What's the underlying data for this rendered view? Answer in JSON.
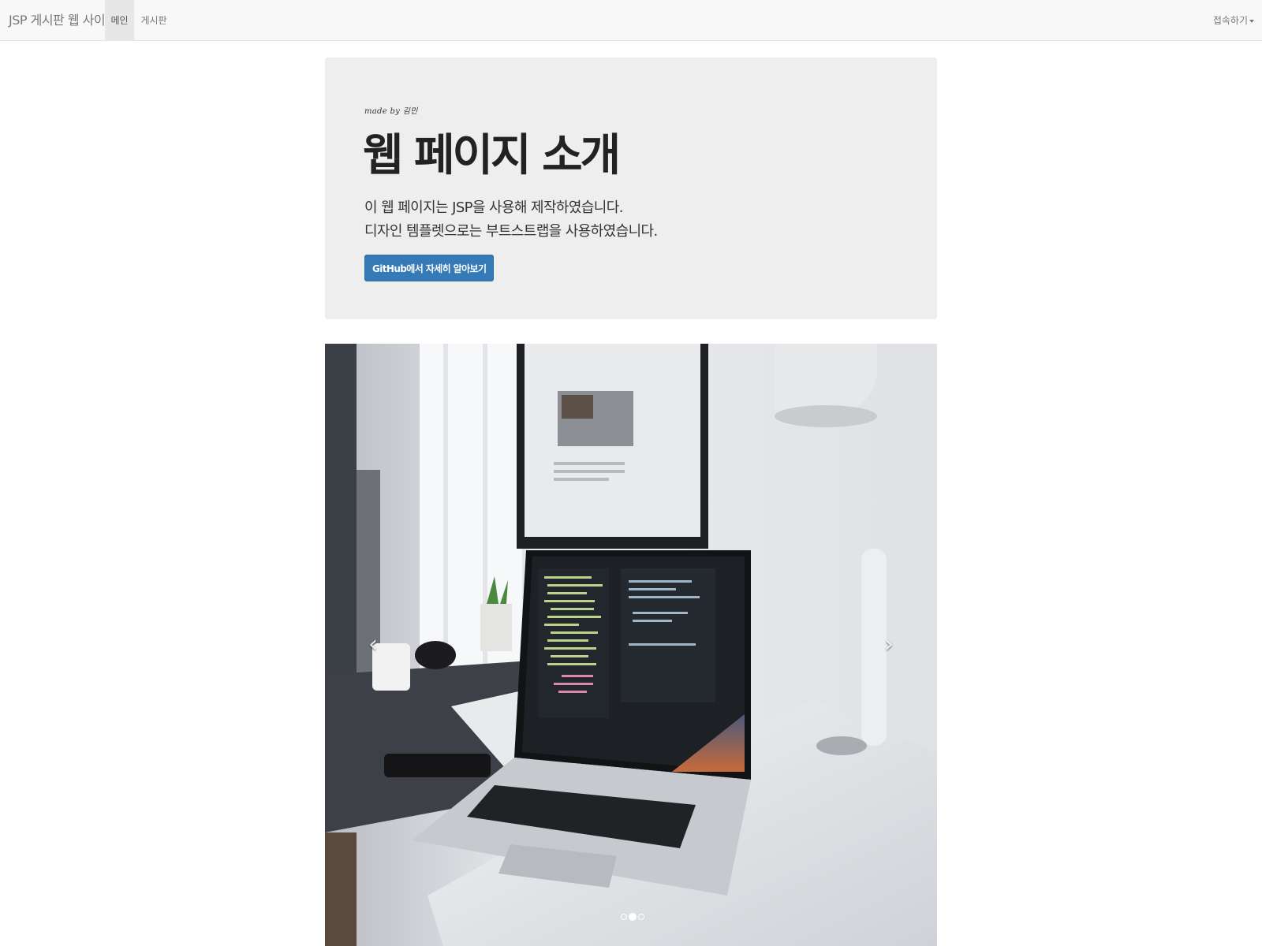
{
  "navbar": {
    "brand": "JSP 게시판 웹 사이트",
    "items": [
      {
        "label": "메인",
        "active": true
      },
      {
        "label": "게시판",
        "active": false
      }
    ],
    "dropdown_label": "접속하기"
  },
  "jumbotron": {
    "made_by": "made by 김민",
    "title": "웹 페이지 소개",
    "line1": "이 웹 페이지는 JSP을 사용해 제작하였습니다.",
    "line2": "디자인 템플렛으로는 부트스트랩을 사용하였습니다.",
    "button_label": "GitHub에서 자세히 알아보기"
  },
  "carousel": {
    "slide_count": 3,
    "active_index": 1,
    "image": "desk-laptop-code-photo"
  },
  "colors": {
    "primary_button": "#337ab7",
    "jumbotron_bg": "#eeeeee",
    "navbar_bg": "#f8f8f8"
  }
}
